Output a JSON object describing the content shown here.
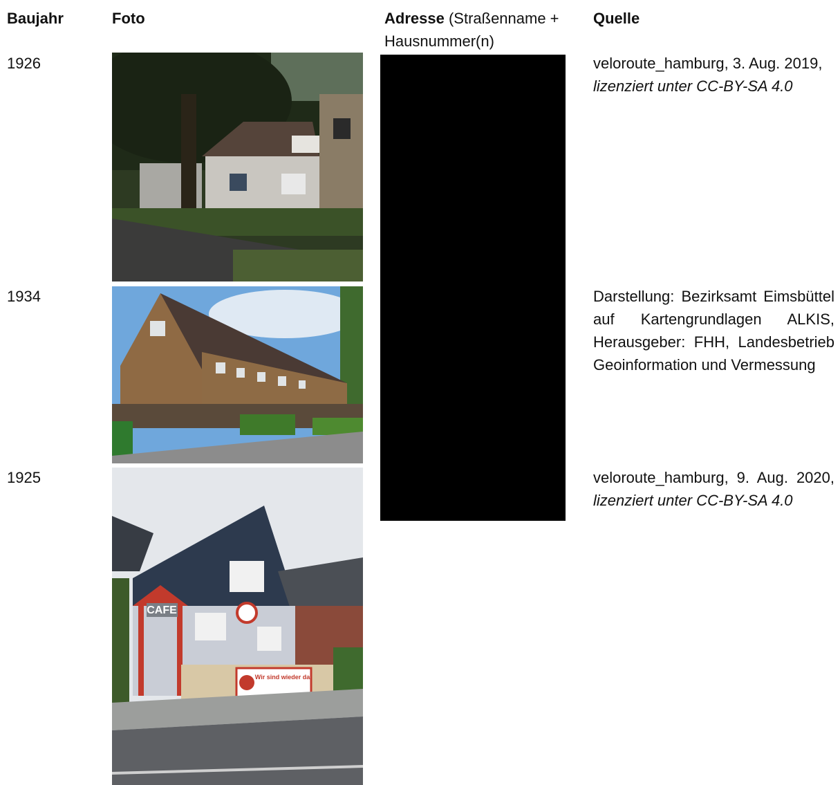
{
  "headers": {
    "year": "Baujahr",
    "photo": "Foto",
    "address_bold": "Adresse",
    "address_rest": " (Straßenname +",
    "address_line2": "Hausnummer(n)",
    "source": "Quelle"
  },
  "rows": [
    {
      "year": "1926",
      "source_plain": "veloroute_hamburg, 3. Aug. 2019,",
      "source_license": "lizenziert unter CC-BY-SA 4.0"
    },
    {
      "year": "1934",
      "source_plain": "Darstellung: Bezirksamt Eims­büttel auf Kartengrundlagen AL­KIS, Herausgeber: FHH, Landes­betrieb Geoinformation und Vermessung"
    },
    {
      "year": "1925",
      "source_plain": "veloroute_hamburg, 9. Aug. 2020,",
      "source_license": "lizenziert unter CC-BY-SA 4.0",
      "cafe_sign": "CAFE",
      "banner_text": "Wir sind wieder da!"
    }
  ]
}
